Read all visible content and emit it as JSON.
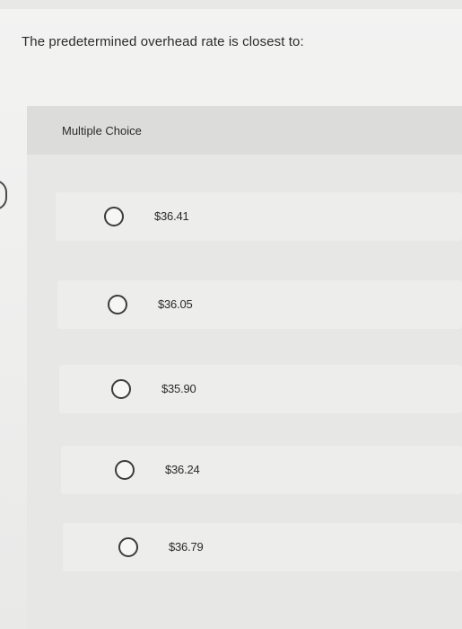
{
  "question": {
    "text": "The predetermined overhead rate is closest to:"
  },
  "multiple_choice": {
    "title": "Multiple Choice",
    "options": [
      {
        "label": "$36.41",
        "selected": false
      },
      {
        "label": "$36.05",
        "selected": false
      },
      {
        "label": "$35.90",
        "selected": false
      },
      {
        "label": "$36.24",
        "selected": false
      },
      {
        "label": "$36.79",
        "selected": false
      }
    ]
  }
}
